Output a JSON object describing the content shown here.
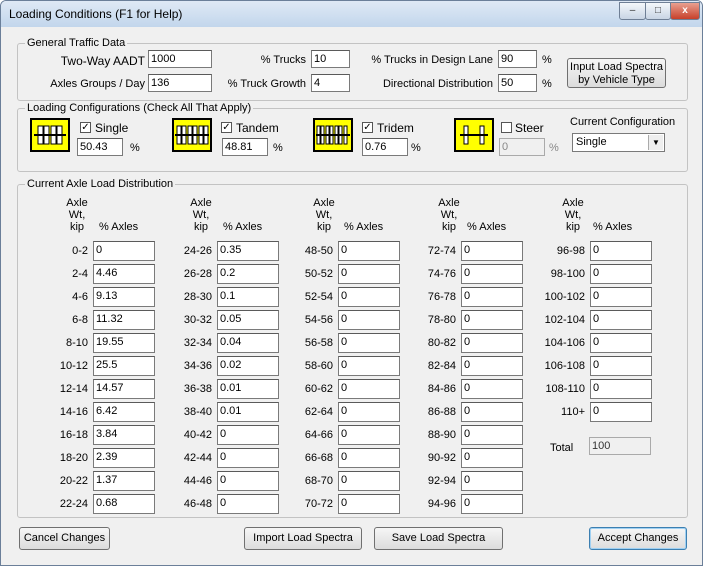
{
  "window": {
    "title": "Loading Conditions (F1 for Help)",
    "min_label": "–",
    "max_label": "□",
    "close_label": "x"
  },
  "general": {
    "title": "General Traffic Data",
    "aadt_label": "Two-Way AADT",
    "aadt_value": "1000",
    "axles_label": "Axles Groups / Day",
    "axles_value": "136",
    "trucks_label": "% Trucks",
    "trucks_value": "10",
    "growth_label": "% Truck Growth",
    "growth_value": "4",
    "design_lane_label": "% Trucks in Design Lane",
    "design_lane_value": "90",
    "dir_label": "Directional Distribution",
    "dir_value": "50",
    "pct": "%",
    "input_spectra_button": [
      "Input Load Spectra",
      "by Vehicle Type"
    ]
  },
  "loading": {
    "title": "Loading Configurations (Check All That Apply)",
    "configs": [
      {
        "name": "Single",
        "checked": true,
        "value": "50.43",
        "icon": "single-axle-icon"
      },
      {
        "name": "Tandem",
        "checked": true,
        "value": "48.81",
        "icon": "tandem-axle-icon"
      },
      {
        "name": "Tridem",
        "checked": true,
        "value": "0.76",
        "icon": "tridem-axle-icon"
      },
      {
        "name": "Steer",
        "checked": false,
        "value": "0",
        "icon": "steer-axle-icon"
      }
    ],
    "pct": "%",
    "current_label": "Current Configuration",
    "current_value": "Single"
  },
  "distribution": {
    "title": "Current Axle Load Distribution",
    "col_header": [
      "Axle",
      "Wt,",
      "kip"
    ],
    "pct_header": "% Axles",
    "columns": [
      [
        [
          "0-2",
          "0"
        ],
        [
          "2-4",
          "4.46"
        ],
        [
          "4-6",
          "9.13"
        ],
        [
          "6-8",
          "11.32"
        ],
        [
          "8-10",
          "19.55"
        ],
        [
          "10-12",
          "25.5"
        ],
        [
          "12-14",
          "14.57"
        ],
        [
          "14-16",
          "6.42"
        ],
        [
          "16-18",
          "3.84"
        ],
        [
          "18-20",
          "2.39"
        ],
        [
          "20-22",
          "1.37"
        ],
        [
          "22-24",
          "0.68"
        ]
      ],
      [
        [
          "24-26",
          "0.35"
        ],
        [
          "26-28",
          "0.2"
        ],
        [
          "28-30",
          "0.1"
        ],
        [
          "30-32",
          "0.05"
        ],
        [
          "32-34",
          "0.04"
        ],
        [
          "34-36",
          "0.02"
        ],
        [
          "36-38",
          "0.01"
        ],
        [
          "38-40",
          "0.01"
        ],
        [
          "40-42",
          "0"
        ],
        [
          "42-44",
          "0"
        ],
        [
          "44-46",
          "0"
        ],
        [
          "46-48",
          "0"
        ]
      ],
      [
        [
          "48-50",
          "0"
        ],
        [
          "50-52",
          "0"
        ],
        [
          "52-54",
          "0"
        ],
        [
          "54-56",
          "0"
        ],
        [
          "56-58",
          "0"
        ],
        [
          "58-60",
          "0"
        ],
        [
          "60-62",
          "0"
        ],
        [
          "62-64",
          "0"
        ],
        [
          "64-66",
          "0"
        ],
        [
          "66-68",
          "0"
        ],
        [
          "68-70",
          "0"
        ],
        [
          "70-72",
          "0"
        ]
      ],
      [
        [
          "72-74",
          "0"
        ],
        [
          "74-76",
          "0"
        ],
        [
          "76-78",
          "0"
        ],
        [
          "78-80",
          "0"
        ],
        [
          "80-82",
          "0"
        ],
        [
          "82-84",
          "0"
        ],
        [
          "84-86",
          "0"
        ],
        [
          "86-88",
          "0"
        ],
        [
          "88-90",
          "0"
        ],
        [
          "90-92",
          "0"
        ],
        [
          "92-94",
          "0"
        ],
        [
          "94-96",
          "0"
        ]
      ],
      [
        [
          "96-98",
          "0"
        ],
        [
          "98-100",
          "0"
        ],
        [
          "100-102",
          "0"
        ],
        [
          "102-104",
          "0"
        ],
        [
          "104-106",
          "0"
        ],
        [
          "106-108",
          "0"
        ],
        [
          "108-110",
          "0"
        ],
        [
          "110+",
          "0"
        ]
      ]
    ],
    "total_label": "Total",
    "total_value": "100"
  },
  "footer": {
    "cancel": "Cancel Changes",
    "import": "Import Load Spectra",
    "save": "Save Load Spectra",
    "accept": "Accept Changes"
  }
}
